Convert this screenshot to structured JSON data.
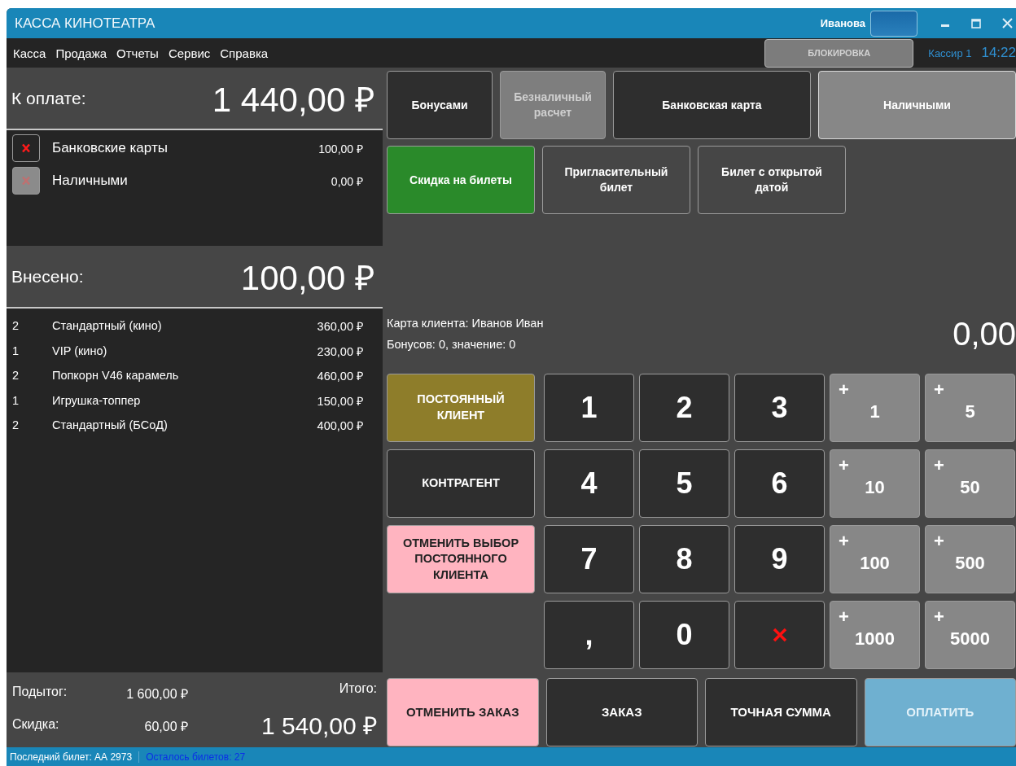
{
  "window": {
    "title": "КАССА КИНОТЕАТРА",
    "user": "Иванова"
  },
  "menu": [
    {
      "label": "Касса"
    },
    {
      "label": "Продажа"
    },
    {
      "label": "Отчеты"
    },
    {
      "label": "Сервис"
    },
    {
      "label": "Справка"
    }
  ],
  "toolbar": {
    "lock_button": {
      "label": "БЛОКИРОВКА",
      "disabled": true
    },
    "cashier": "Кассир 1",
    "time": "14:22"
  },
  "to_pay": {
    "label": "К оплате:",
    "amount": "1 440,00 ₽"
  },
  "payments": [
    {
      "name": "Банковские карты",
      "amount": "100,00 ₽",
      "removable": true
    },
    {
      "name": "Наличными",
      "amount": "0,00 ₽",
      "removable": false
    }
  ],
  "paid": {
    "label": "Внесено:",
    "amount": "100,00 ₽"
  },
  "order_items": [
    {
      "qty": "2",
      "name": "Стандартный (кино)",
      "price": "360,00 ₽"
    },
    {
      "qty": "1",
      "name": "VIP (кино)",
      "price": "230,00 ₽"
    },
    {
      "qty": "2",
      "name": "Попкорн V46 карамель",
      "price": "460,00 ₽"
    },
    {
      "qty": "1",
      "name": "Игрушка-топпер",
      "price": "150,00 ₽"
    },
    {
      "qty": "2",
      "name": "Стандартный (БСоД)",
      "price": "400,00 ₽"
    }
  ],
  "totals": {
    "subtotal_label": "Подытог:",
    "subtotal": "1 600,00 ₽",
    "discount_label": "Скидка:",
    "discount": "60,00 ₽",
    "total_label": "Итого:",
    "total": "1 540,00 ₽"
  },
  "status_bar": {
    "last_ticket": "Последний билет: АА 2973",
    "tickets_left": "Осталось билетов: 27"
  },
  "payment_methods": [
    {
      "label": "Бонусами",
      "disabled": false,
      "selected": false
    },
    {
      "label": "Безналичный расчет",
      "disabled": true,
      "selected": false
    },
    {
      "label": "Банковская карта",
      "disabled": false,
      "selected": false
    },
    {
      "label": "Наличными",
      "disabled": false,
      "selected": true
    }
  ],
  "discounts": [
    {
      "label": "Скидка на билеты",
      "selected": true
    },
    {
      "label": "Пригласительный билет",
      "selected": false
    },
    {
      "label": "Билет с открытой датой",
      "selected": false
    }
  ],
  "client": {
    "card": "Карта клиента: Иванов Иван",
    "bonuses": "Бонусов: 0, значение: 0",
    "amount": "0,00"
  },
  "client_actions": [
    {
      "label": "ПОСТОЯННЫЙ КЛИЕНТ",
      "kind": "loyal"
    },
    {
      "label": "КОНТРАГЕНТ",
      "kind": "plain"
    },
    {
      "label": "ОТМЕНИТЬ ВЫБОР ПОСТОЯННОГО КЛИЕНТА",
      "kind": "cancel"
    }
  ],
  "keypad": [
    {
      "kind": "digit",
      "label": "1"
    },
    {
      "kind": "digit",
      "label": "2"
    },
    {
      "kind": "digit",
      "label": "3"
    },
    {
      "kind": "add",
      "sign": "+",
      "label": "1"
    },
    {
      "kind": "add",
      "sign": "+",
      "label": "5"
    },
    {
      "kind": "digit",
      "label": "4"
    },
    {
      "kind": "digit",
      "label": "5"
    },
    {
      "kind": "digit",
      "label": "6"
    },
    {
      "kind": "add",
      "sign": "+",
      "label": "10"
    },
    {
      "kind": "add",
      "sign": "+",
      "label": "50"
    },
    {
      "kind": "digit",
      "label": "7"
    },
    {
      "kind": "digit",
      "label": "8"
    },
    {
      "kind": "digit",
      "label": "9"
    },
    {
      "kind": "add",
      "sign": "+",
      "label": "100"
    },
    {
      "kind": "add",
      "sign": "+",
      "label": "500"
    },
    {
      "kind": "digit",
      "label": ","
    },
    {
      "kind": "digit",
      "label": "0"
    },
    {
      "kind": "delete"
    },
    {
      "kind": "add",
      "sign": "+",
      "label": "1000"
    },
    {
      "kind": "add",
      "sign": "+",
      "label": "5000"
    }
  ],
  "bottom_buttons": [
    {
      "label": "ОТМЕНИТЬ ЗАКАЗ",
      "kind": "cancel",
      "disabled": false
    },
    {
      "label": "ЗАКАЗ",
      "kind": "plain",
      "disabled": false
    },
    {
      "label": "ТОЧНАЯ СУММА",
      "kind": "plain",
      "disabled": false
    },
    {
      "label": "ОПЛАТИТЬ",
      "kind": "primary",
      "disabled": true
    }
  ]
}
